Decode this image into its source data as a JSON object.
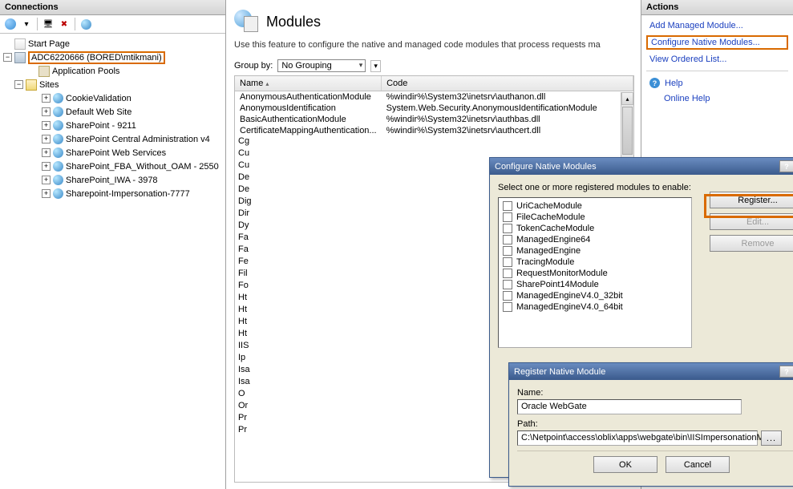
{
  "panels": {
    "connections_title": "Connections",
    "actions_title": "Actions"
  },
  "tree": {
    "start_page": "Start Page",
    "server": "ADC6220666 (BORED\\mtikmani)",
    "app_pools": "Application Pools",
    "sites_label": "Sites",
    "sites": [
      "CookieValidation",
      "Default Web Site",
      "SharePoint - 9211",
      "SharePoint Central Administration v4",
      "SharePoint Web Services",
      "SharePoint_FBA_Without_OAM - 2550",
      "SharePoint_IWA - 3978",
      "Sharepoint-Impersonation-7777"
    ]
  },
  "center": {
    "title": "Modules",
    "description": "Use this feature to configure the native and managed code modules that process requests ma",
    "groupby_label": "Group by:",
    "groupby_value": "No Grouping",
    "col_name": "Name",
    "col_code": "Code",
    "rows": [
      {
        "name": "AnonymousAuthenticationModule",
        "code": "%windir%\\System32\\inetsrv\\authanon.dll"
      },
      {
        "name": "AnonymousIdentification",
        "code": "System.Web.Security.AnonymousIdentificationModule"
      },
      {
        "name": "BasicAuthenticationModule",
        "code": "%windir%\\System32\\inetsrv\\authbas.dll"
      },
      {
        "name": "CertificateMappingAuthentication...",
        "code": "%windir%\\System32\\inetsrv\\authcert.dll"
      }
    ],
    "trunc_names": [
      "Cg",
      "Cu",
      "Cu",
      "De",
      "De",
      "Dig",
      "Dir",
      "Dy",
      "Fa",
      "Fa",
      "Fe",
      "Fil",
      "Fo",
      "Ht",
      "Ht",
      "Ht",
      "Ht",
      "IIS",
      "Ip",
      "Isa",
      "Isa",
      "O",
      "Or",
      "Pr",
      "Pr"
    ]
  },
  "actions": {
    "add_managed": "Add Managed Module...",
    "config_native": "Configure Native Modules...",
    "view_ordered": "View Ordered List...",
    "help": "Help",
    "online_help": "Online Help"
  },
  "dlg1": {
    "title": "Configure Native Modules",
    "instructions": "Select one or more registered modules to enable:",
    "modules": [
      "UriCacheModule",
      "FileCacheModule",
      "TokenCacheModule",
      "ManagedEngine64",
      "ManagedEngine",
      "TracingModule",
      "RequestMonitorModule",
      "SharePoint14Module",
      "ManagedEngineV4.0_32bit",
      "ManagedEngineV4.0_64bit"
    ],
    "btn_register": "Register...",
    "btn_edit": "Edit...",
    "btn_remove": "Remove"
  },
  "dlg2": {
    "title": "Register Native Module",
    "name_label": "Name:",
    "name_value": "Oracle WebGate",
    "path_label": "Path:",
    "path_value": "C:\\Netpoint\\access\\oblix\\apps\\webgate\\bin\\IISImpersonationMod",
    "btn_ok": "OK",
    "btn_cancel": "Cancel"
  }
}
